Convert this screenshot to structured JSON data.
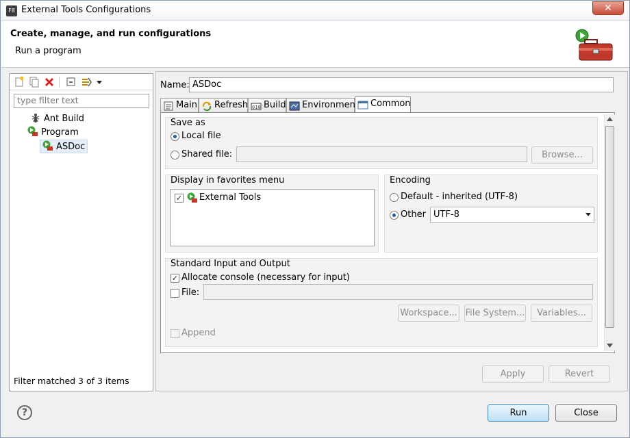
{
  "window": {
    "title": "External Tools Configurations",
    "app_icon_text": "F8",
    "close_glyph": "✕"
  },
  "header": {
    "title": "Create, manage, and run configurations",
    "subtitle": "Run a program"
  },
  "left": {
    "filter_placeholder": "type filter text",
    "tree": [
      {
        "label": "Ant Build",
        "icon": "ant-icon"
      },
      {
        "label": "Program",
        "icon": "program-run-icon"
      },
      {
        "label": "ASDoc",
        "icon": "program-config-icon",
        "selected": true
      }
    ],
    "status": "Filter matched 3 of 3 items"
  },
  "config": {
    "name_label": "Name:",
    "name_value": "ASDoc",
    "tabs": [
      {
        "label": "Main",
        "icon": "main-tab-icon"
      },
      {
        "label": "Refresh",
        "icon": "refresh-tab-icon"
      },
      {
        "label": "Build",
        "icon": "build-tab-icon"
      },
      {
        "label": "Environment",
        "icon": "environment-tab-icon"
      },
      {
        "label": "Common",
        "icon": "common-tab-icon",
        "active": true
      }
    ]
  },
  "common": {
    "save_as": {
      "title": "Save as",
      "local": "Local file",
      "shared": "Shared file:",
      "browse": "Browse..."
    },
    "favorites": {
      "title": "Display in favorites menu",
      "items": [
        {
          "label": "External Tools",
          "checked": true
        }
      ]
    },
    "encoding": {
      "title": "Encoding",
      "default": "Default - inherited (UTF-8)",
      "other": "Other",
      "other_value": "UTF-8"
    },
    "io": {
      "title": "Standard Input and Output",
      "allocate": "Allocate console (necessary for input)",
      "file": "File:",
      "workspace": "Workspace...",
      "filesystem": "File System...",
      "variables": "Variables...",
      "append": "Append"
    }
  },
  "buttons": {
    "apply": "Apply",
    "revert": "Revert",
    "run": "Run",
    "close": "Close",
    "help": "?"
  },
  "colors": {
    "accent": "#3c7fb1",
    "selection": "#e5eef9",
    "close_red": "#c74b38"
  }
}
